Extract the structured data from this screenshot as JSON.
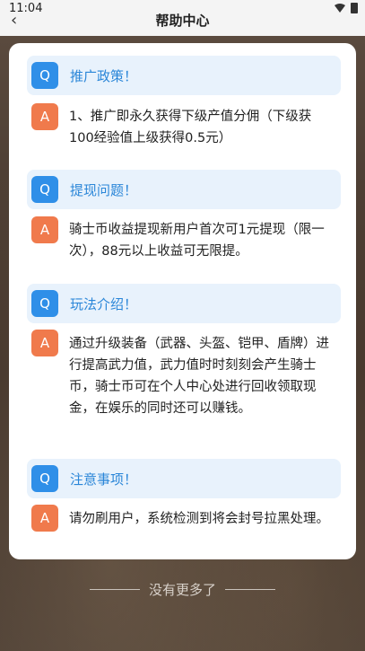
{
  "status_bar": {
    "time": "11:04"
  },
  "header": {
    "title": "帮助中心"
  },
  "faq": [
    {
      "q_badge": "Q",
      "question": "推广政策！",
      "a_badge": "A",
      "answer": "1、推广即永久获得下级产值分佣（下级获100经验值上级获得0.5元）"
    },
    {
      "q_badge": "Q",
      "question": "提现问题！",
      "a_badge": "A",
      "answer": "骑士币收益提现新用户首次可1元提现（限一次），88元以上收益可无限提。"
    },
    {
      "q_badge": "Q",
      "question": "玩法介绍！",
      "a_badge": "A",
      "answer": "通过升级装备（武器、头盔、铠甲、盾牌）进行提高武力值，武力值时时刻刻会产生骑士币，骑士币可在个人中心处进行回收领取现金，在娱乐的同时还可以赚钱。"
    },
    {
      "q_badge": "Q",
      "question": "注意事项！",
      "a_badge": "A",
      "answer": "请勿刷用户，系统检测到将会封号拉黑处理。"
    }
  ],
  "footer": {
    "text": "没有更多了"
  },
  "colors": {
    "q_badge": "#2f8fe8",
    "a_badge": "#f07a4c",
    "question_text": "#2a86d8",
    "question_bg": "#e8f2fc"
  }
}
